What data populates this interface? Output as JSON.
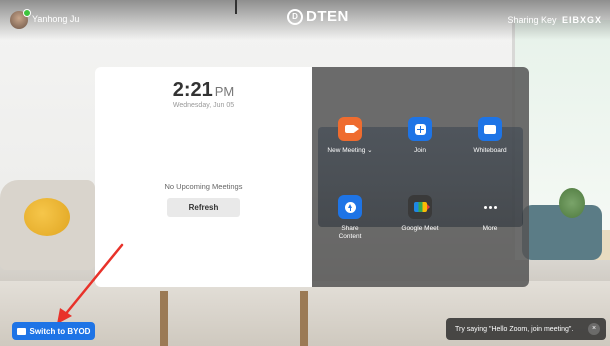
{
  "header": {
    "user_name": "Yanhong Ju",
    "logo_text": "DTEN",
    "sharing_label": "Sharing Key",
    "sharing_key": "EIBXGX"
  },
  "clock": {
    "time": "2:21",
    "ampm": "PM",
    "date": "Wednesday, Jun 05"
  },
  "meetings": {
    "empty_text": "No Upcoming Meetings",
    "refresh_label": "Refresh"
  },
  "actions": [
    {
      "label": "New Meeting ⌄",
      "icon": "video-camera-icon"
    },
    {
      "label": "Join",
      "icon": "plus-icon"
    },
    {
      "label": "Whiteboard",
      "icon": "whiteboard-icon"
    },
    {
      "label": "Share\nContent",
      "icon": "upload-icon"
    },
    {
      "label": "Google Meet",
      "icon": "google-meet-icon"
    },
    {
      "label": "More",
      "icon": "more-dots-icon"
    }
  ],
  "footer": {
    "byod_label": "Switch to BYOD",
    "toast_text": "Try saying \"Hello Zoom, join meeting\".",
    "toast_close": "×"
  },
  "colors": {
    "accent_blue": "#1e74e6",
    "accent_orange": "#ef6c2f",
    "arrow_red": "#e8322a"
  }
}
